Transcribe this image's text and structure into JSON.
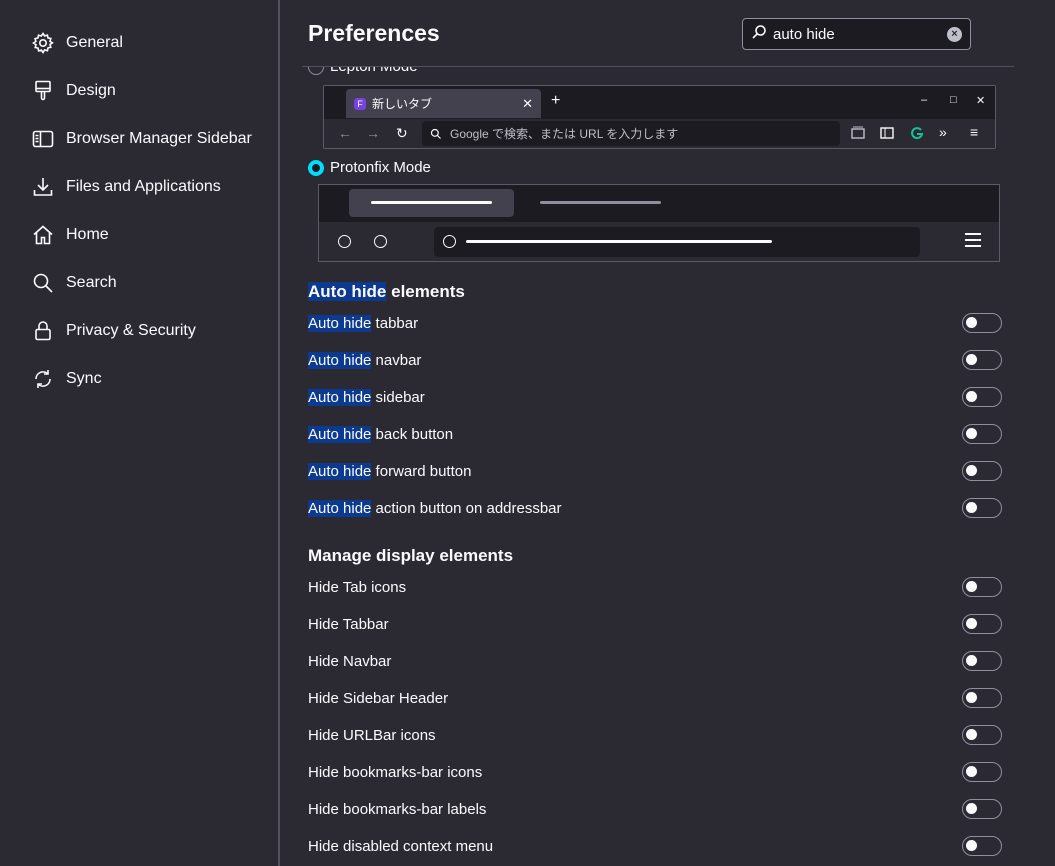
{
  "sidebar": {
    "items": [
      {
        "label": "General",
        "icon": "gear-icon"
      },
      {
        "label": "Design",
        "icon": "paintbrush-icon"
      },
      {
        "label": "Browser Manager Sidebar",
        "icon": "sidebar-icon"
      },
      {
        "label": "Files and Applications",
        "icon": "download-icon"
      },
      {
        "label": "Home",
        "icon": "home-icon"
      },
      {
        "label": "Search",
        "icon": "search-icon"
      },
      {
        "label": "Privacy & Security",
        "icon": "lock-icon"
      },
      {
        "label": "Sync",
        "icon": "sync-icon"
      }
    ]
  },
  "header": {
    "title": "Preferences",
    "search_value": "auto hide"
  },
  "modes": {
    "lepton_label": "Lepton Mode",
    "protonfix_label": "Protonfix Mode",
    "selected": "Protonfix Mode"
  },
  "lepton_preview": {
    "tab_title": "新しいタブ",
    "url_placeholder": "Google で検索、または URL を入力します"
  },
  "auto_hide": {
    "title_highlight": "Auto hide",
    "title_rest": " elements",
    "items": [
      {
        "highlight": "Auto hide",
        "rest": " tabbar",
        "enabled": false
      },
      {
        "highlight": "Auto hide",
        "rest": " navbar",
        "enabled": false
      },
      {
        "highlight": "Auto hide",
        "rest": " sidebar",
        "enabled": false
      },
      {
        "highlight": "Auto hide",
        "rest": " back button",
        "enabled": false
      },
      {
        "highlight": "Auto hide",
        "rest": " forward button",
        "enabled": false
      },
      {
        "highlight": "Auto hide",
        "rest": " action button on addressbar",
        "enabled": false
      }
    ]
  },
  "manage_display": {
    "title": "Manage display elements",
    "items": [
      {
        "label": "Hide Tab icons",
        "enabled": false
      },
      {
        "label": "Hide Tabbar",
        "enabled": false
      },
      {
        "label": "Hide Navbar",
        "enabled": false
      },
      {
        "label": "Hide Sidebar Header",
        "enabled": false
      },
      {
        "label": "Hide URLBar icons",
        "enabled": false
      },
      {
        "label": "Hide bookmarks-bar icons",
        "enabled": false
      },
      {
        "label": "Hide bookmarks-bar labels",
        "enabled": false
      },
      {
        "label": "Hide disabled context menu",
        "enabled": false
      }
    ]
  },
  "colors": {
    "background": "#2b2a33",
    "highlight": "#0b3a8f",
    "accent": "#00ddff"
  }
}
